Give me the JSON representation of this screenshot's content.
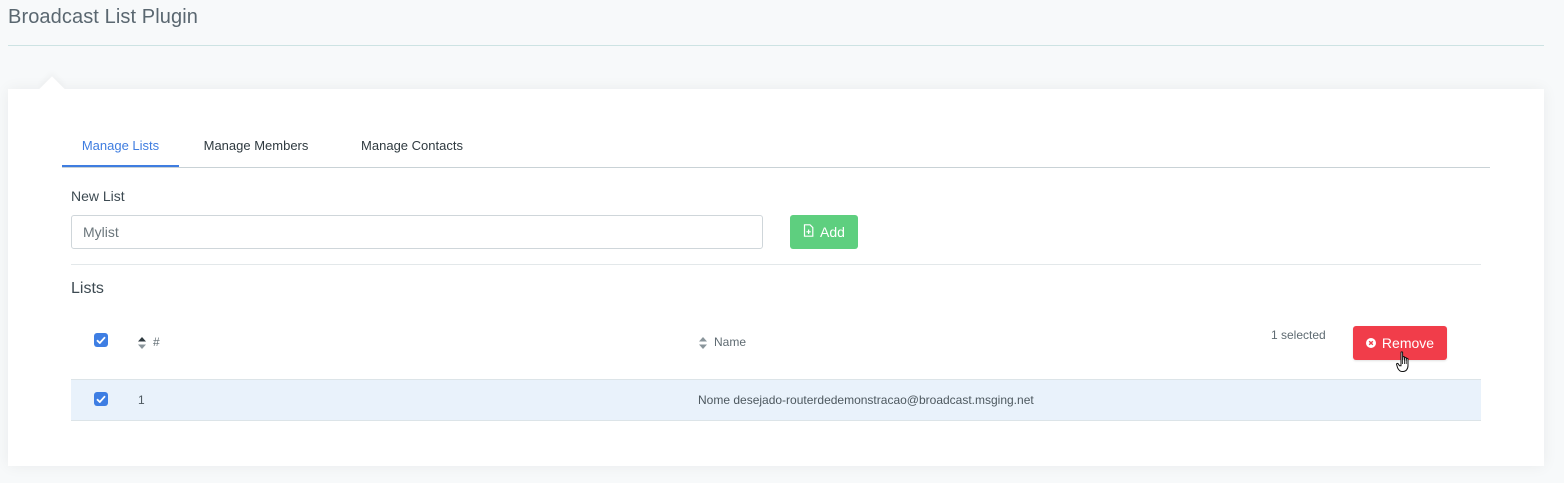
{
  "page": {
    "title": "Broadcast List Plugin"
  },
  "tabs": [
    {
      "label": "Manage Lists",
      "active": true
    },
    {
      "label": "Manage Members",
      "active": false
    },
    {
      "label": "Manage Contacts",
      "active": false
    }
  ],
  "new_list": {
    "label": "New List",
    "input_value": "Mylist",
    "add_label": "Add"
  },
  "lists": {
    "title": "Lists",
    "columns": [
      "#",
      "Name"
    ],
    "selected_text": "1 selected",
    "remove_label": "Remove",
    "rows": [
      {
        "number": "1",
        "name": "Nome desejado-routerdedemonstracao@broadcast.msging.net",
        "checked": true
      }
    ]
  },
  "colors": {
    "accent": "#3f7de0",
    "add_button": "#5ecf7f",
    "remove_button": "#f13d4a",
    "selected_row": "#e9f2fb"
  },
  "icons": {
    "add": "file-plus-icon",
    "remove": "x-circle-icon",
    "sort": "sort-icon",
    "cursor": "hand-pointer-icon"
  }
}
